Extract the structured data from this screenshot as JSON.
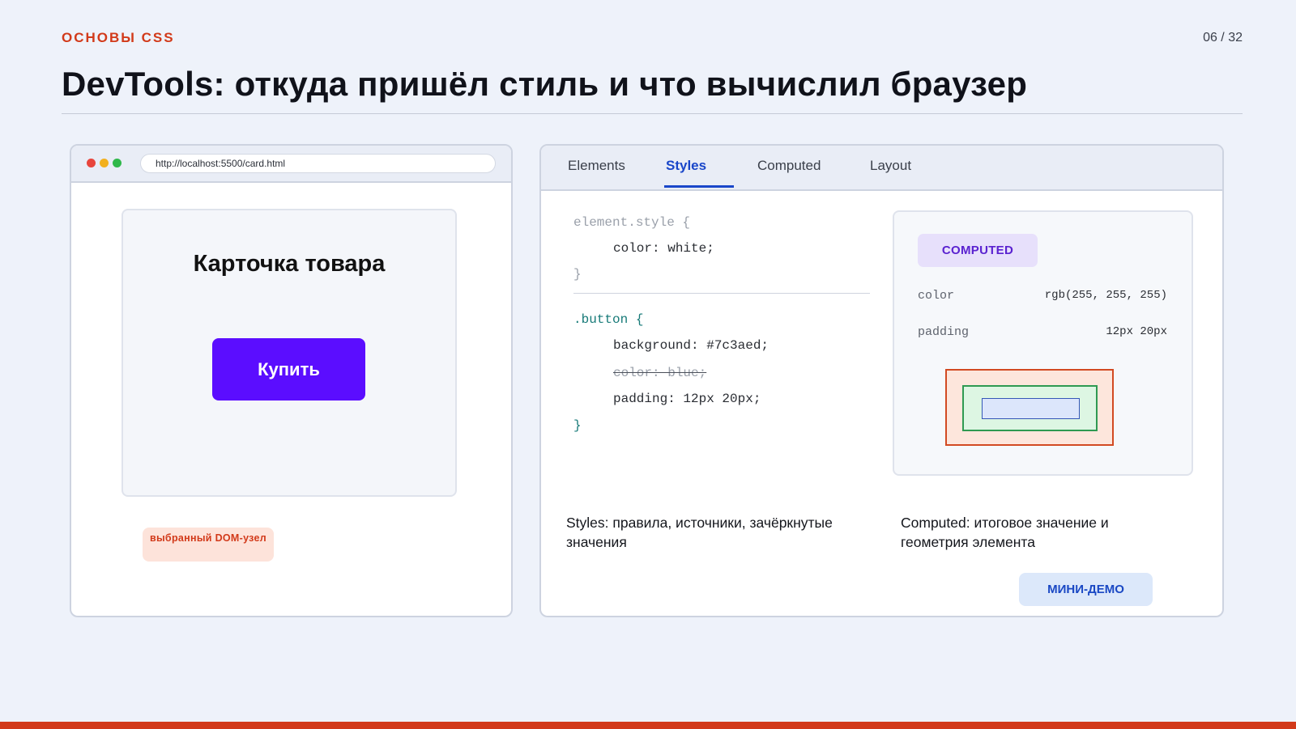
{
  "slide": {
    "kicker": "ОСНОВЫ CSS",
    "page_number": "06 / 32",
    "title": "DevTools: откуда пришёл стиль и что вычислил браузер"
  },
  "browser": {
    "url": "http://localhost:5500/card.html",
    "card_title": "Карточка товара",
    "buy_button_label": "Купить",
    "dom_badge": "выбранный DOM-узел"
  },
  "devtools": {
    "tabs": [
      {
        "label": "Elements",
        "active": false
      },
      {
        "label": "Styles",
        "active": true
      },
      {
        "label": "Computed",
        "active": false
      },
      {
        "label": "Layout",
        "active": false
      }
    ],
    "styles": {
      "element_style_selector": "element.style {",
      "element_style_decl": "color: white;",
      "element_style_close": "}",
      "button_selector": ".button {",
      "button_decl_1": "background: #7c3aed;",
      "button_decl_overridden": "color: blue;",
      "button_decl_3": "padding: 12px 20px;",
      "button_close": "}"
    },
    "computed": {
      "badge": "COMPUTED",
      "properties": [
        {
          "name": "color",
          "value": "rgb(255, 255, 255)"
        },
        {
          "name": "padding",
          "value": "12px 20px"
        }
      ]
    },
    "captions": {
      "styles": "Styles: правила, источники, зачёркнутые значения",
      "computed": "Computed: итоговое значение и геометрия элемента"
    },
    "mini_demo_label": "МИНИ-ДЕМО"
  },
  "colors": {
    "accent": "#d23a1a",
    "buy_button": "#5b0dff",
    "active_tab": "#1946c9",
    "computed_badge": "#5a22d0"
  }
}
